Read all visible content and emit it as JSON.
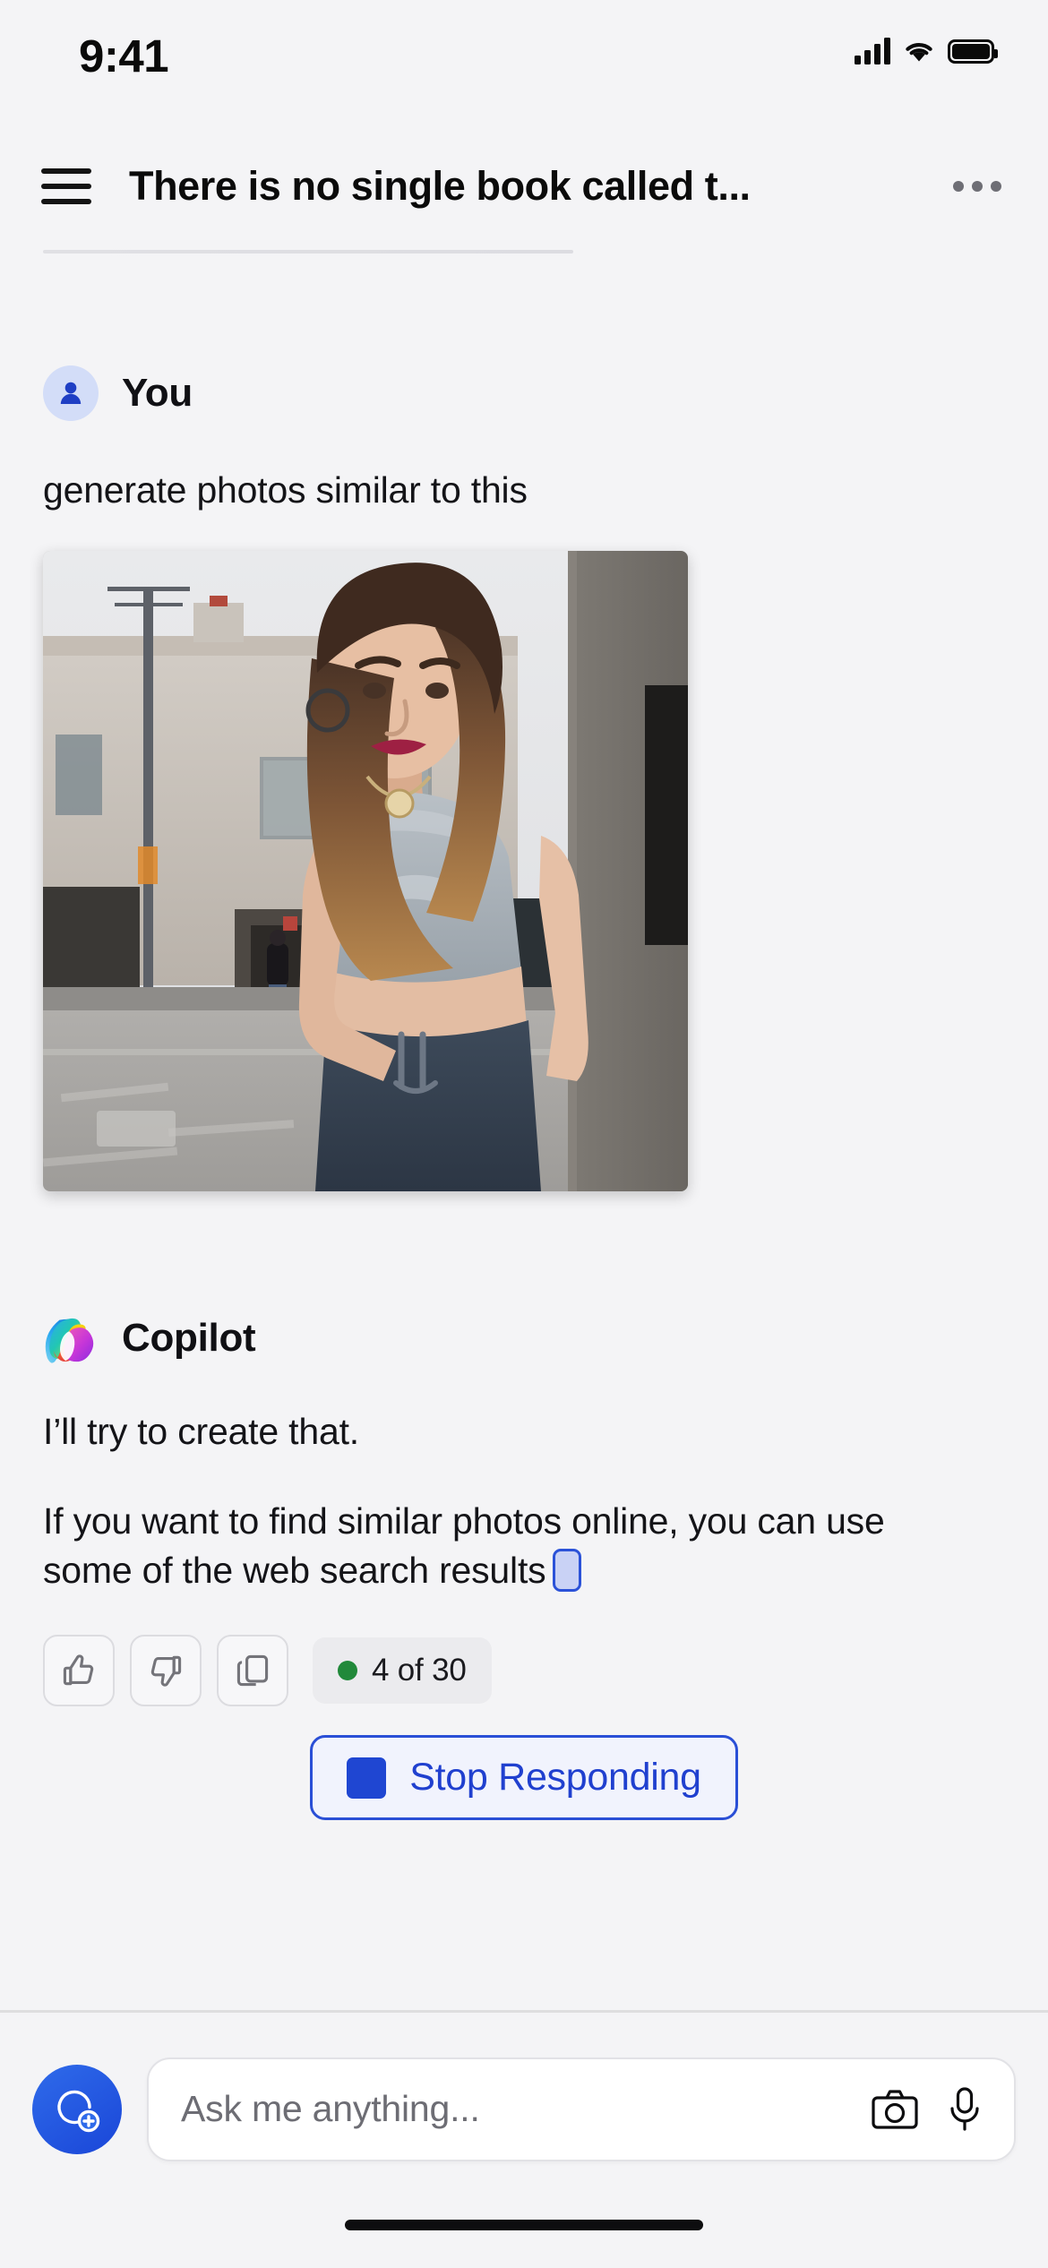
{
  "status_bar": {
    "time": "9:41",
    "signal_icon": "cellular-signal-icon",
    "wifi_icon": "wifi-icon",
    "battery_icon": "battery-full-icon"
  },
  "header": {
    "menu_icon": "hamburger-menu-icon",
    "title": "There is no single book called t...",
    "overflow_icon": "more-options-icon"
  },
  "conversation": {
    "user": {
      "avatar_icon": "person-avatar-icon",
      "name": "You",
      "message": "generate photos similar to this",
      "attachment": {
        "name": "attached-photo",
        "description": "Photo of a woman in a gray crop top and blue drawstring pants standing by a concrete wall on a city street"
      }
    },
    "assistant": {
      "avatar_icon": "copilot-logo-icon",
      "name": "Copilot",
      "paragraphs": [
        "I’ll try to create that.",
        "If you want to find similar photos online, you can use some of the web search results"
      ],
      "citation_marker": "citation-chip"
    },
    "feedback": {
      "thumbs_up_icon": "thumbs-up-icon",
      "thumbs_down_icon": "thumbs-down-icon",
      "copy_icon": "copy-icon",
      "counter_text": "4 of 30",
      "counter_dot_color": "#21893a"
    },
    "stop_button": {
      "icon": "stop-square-icon",
      "label": "Stop Responding",
      "accent_color": "#2040cf"
    }
  },
  "composer": {
    "new_chat_icon": "new-chat-bubble-plus-icon",
    "placeholder": "Ask me anything...",
    "value": "",
    "camera_icon": "camera-icon",
    "mic_icon": "microphone-icon"
  },
  "system": {
    "home_indicator": "home-indicator"
  }
}
